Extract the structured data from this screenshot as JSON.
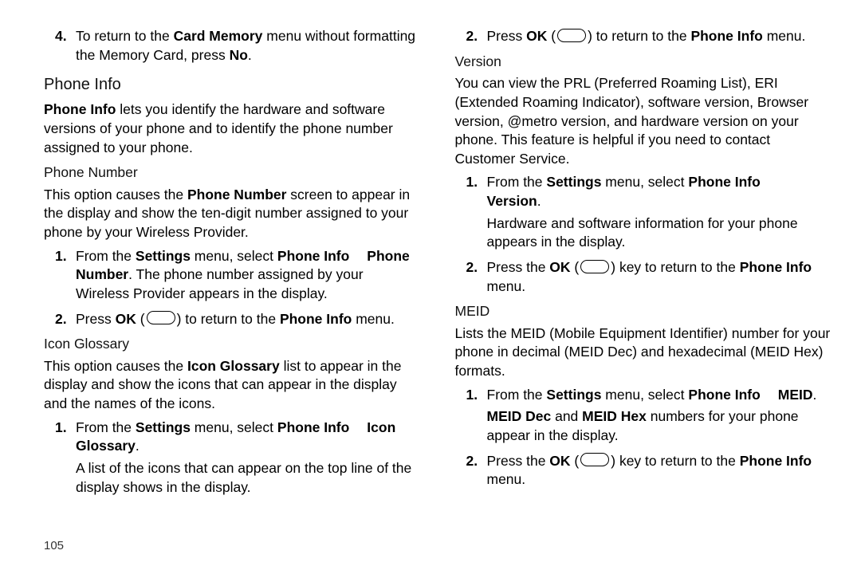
{
  "pageNumber": "105",
  "col1": {
    "step4": {
      "pre": "To return to the ",
      "b1": "Card Memory",
      "mid": " menu without formatting the Memory Card, press ",
      "b2": "No",
      "post": "."
    },
    "phoneInfoTitle": "Phone Info",
    "phoneInfoIntro": {
      "b": "Phone Info",
      "rest": " lets you identify the hardware and software versions of your phone and to identify the phone number assigned to your phone."
    },
    "phoneNumberTitle": "Phone Number",
    "phoneNumberIntro": {
      "pre": "This option causes the ",
      "b": "Phone Number",
      "post": " screen to appear in the display and show the ten-digit number assigned to your phone by your Wireless Provider."
    },
    "pnStep1": {
      "pre": "From the ",
      "b1": "Settings",
      "mid1": " menu, select ",
      "b2": "Phone Info",
      "b3": "Phone Number",
      "post": ". The phone number assigned by your Wireless Provider appears in the display."
    },
    "pnStep2": {
      "pre": "Press ",
      "b1": "OK",
      "paren1": " (",
      "paren2": ") to return to the ",
      "b2": "Phone Info",
      "post": " menu."
    },
    "iconGlossTitle": "Icon Glossary",
    "iconGlossIntro": {
      "pre": "This option causes the ",
      "b": "Icon Glossary",
      "post": " list to appear in the display and show the icons that can appear in the display and the names of the icons."
    },
    "igStep1": {
      "pre": "From the ",
      "b1": "Settings",
      "mid1": " menu, select ",
      "b2": "Phone Info",
      "b3": "Icon Glossary",
      "post": ".",
      "sub": "A list of the icons that can appear on the top line of the display shows in the display."
    }
  },
  "col2": {
    "igStep2": {
      "pre": "Press ",
      "b1": "OK",
      "paren1": " (",
      "paren2": ") to return to the ",
      "b2": "Phone Info",
      "post": " menu."
    },
    "versionTitle": "Version",
    "versionIntro": "You can view the PRL (Preferred Roaming List), ERI (Extended Roaming Indicator), software version, Browser version, @metro version, and hardware version on your phone. This feature is helpful if you need to contact Customer Service.",
    "vStep1": {
      "pre": "From the ",
      "b1": "Settings",
      "mid1": " menu, select ",
      "b2": "Phone Info",
      "b3": "Version",
      "post": ".",
      "sub": "Hardware and software information for your phone appears in the display."
    },
    "vStep2": {
      "pre": "Press the ",
      "b1": "OK",
      "paren1": " (",
      "paren2": ") key to return to the ",
      "b2": "Phone Info",
      "post": " menu."
    },
    "meidTitle": "MEID",
    "meidIntro": "Lists the MEID (Mobile Equipment Identifier) number for your phone in decimal (MEID Dec) and hexadecimal (MEID Hex) formats.",
    "mStep1": {
      "pre": "From the ",
      "b1": "Settings",
      "mid1": " menu, select ",
      "b2": "Phone Info",
      "b3": "MEID",
      "post": ".",
      "subB1": "MEID Dec",
      "subMid": " and ",
      "subB2": "MEID Hex",
      "subPost": " numbers for your phone appear in the display."
    },
    "mStep2": {
      "pre": "Press the ",
      "b1": "OK",
      "paren1": " (",
      "paren2": ") key to return to the ",
      "b2": "Phone Info",
      "post": " menu."
    }
  }
}
